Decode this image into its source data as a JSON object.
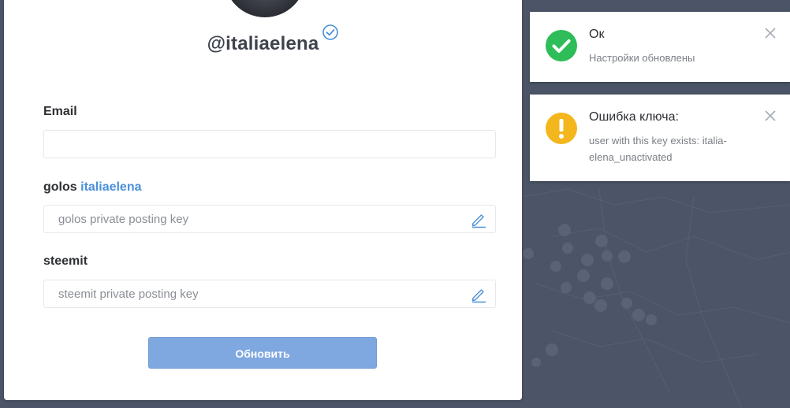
{
  "profile": {
    "username": "@italiaelena"
  },
  "form": {
    "email_label": "Email",
    "email_value": "",
    "golos_label_prefix": "golos",
    "golos_label_account": "italiaelena",
    "golos_placeholder": "golos private posting key",
    "steemit_label": "steemit",
    "steemit_placeholder": "steemit private posting key",
    "submit_label": "Обновить"
  },
  "toasts": [
    {
      "type": "success",
      "icon": "check-circle-icon",
      "color": "#2ebd59",
      "title": "Ок",
      "message": "Настройки обновлены"
    },
    {
      "type": "warning",
      "icon": "exclamation-circle-icon",
      "color": "#f4b61d",
      "title": "Ошибка ключа:",
      "message": "user with this key exists: italia-elena_unactivated"
    }
  ],
  "colors": {
    "accent_link": "#4a90d9",
    "button_bg": "#7fa8e0",
    "background": "#4b5567"
  }
}
